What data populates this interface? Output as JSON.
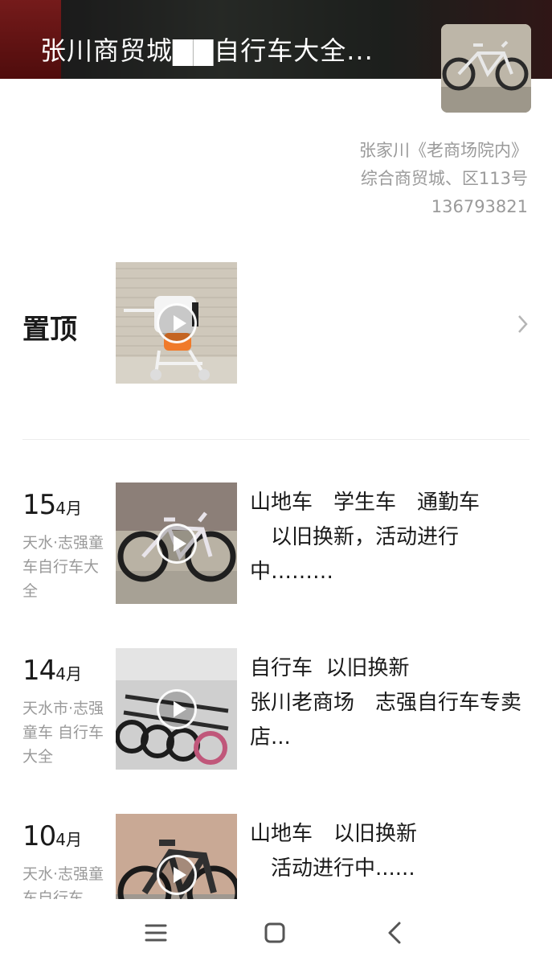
{
  "header": {
    "title": "张川商贸城▇▇自行车大全..."
  },
  "shop_info": {
    "address_line1": "张家川《老商场院内》",
    "address_line2": "综合商贸城、区113号",
    "phone": "136793821"
  },
  "pinned": {
    "label": "置顶"
  },
  "posts": [
    {
      "day": "15",
      "month": "4月",
      "from": "天水·志强童车自行车大全",
      "caption": "山地车　学生车　通勤车\n　以旧换新，活动进行中………"
    },
    {
      "day": "14",
      "month": "4月",
      "from": "天水市·志强童车 自行车大全",
      "caption": "自行车  以旧换新\n张川老商场　志强自行车专卖店..."
    },
    {
      "day": "10",
      "month": "4月",
      "from": "天水·志强童车自行车",
      "caption": "山地车　以旧换新\n　活动进行中......"
    }
  ],
  "icons": {
    "play": "play-icon",
    "chevron": "chevron-right-icon",
    "menu": "menu-icon",
    "home": "home-icon",
    "back": "back-icon"
  },
  "colors": {
    "muted_text": "#9a9a9a",
    "primary_text": "#1a1a1a"
  }
}
